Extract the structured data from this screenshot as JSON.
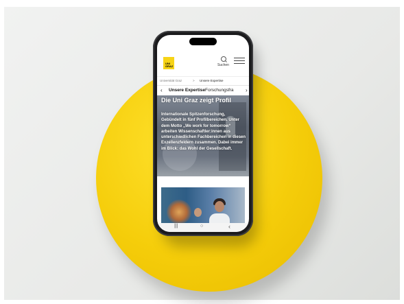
{
  "header": {
    "logo_text": "UNI GRAZ",
    "search_label": "Suchen"
  },
  "breadcrumb": {
    "items": [
      "Universität Graz",
      ">",
      "Unsere Expertise"
    ]
  },
  "tabs": {
    "prev": "‹",
    "items": [
      "Unsere Expertise",
      "Forschungsfra"
    ],
    "next": "›"
  },
  "hero": {
    "title": "Die Uni Graz zeigt Profil",
    "text": "Internationale Spitzenforschung, Gebündelt in fünf Profilbereichen. Unter dem Motto „We work for tomorrow“ arbeiten Wissenschaftler:innen aus unterschiedlichen Fachbereichen in diesen Exzellenzfeldern zusammen. Dabei immer im Blick: das Wohl der Gesellschaft."
  },
  "navbar": {
    "recents": "|||",
    "home": "○",
    "back": "‹"
  }
}
